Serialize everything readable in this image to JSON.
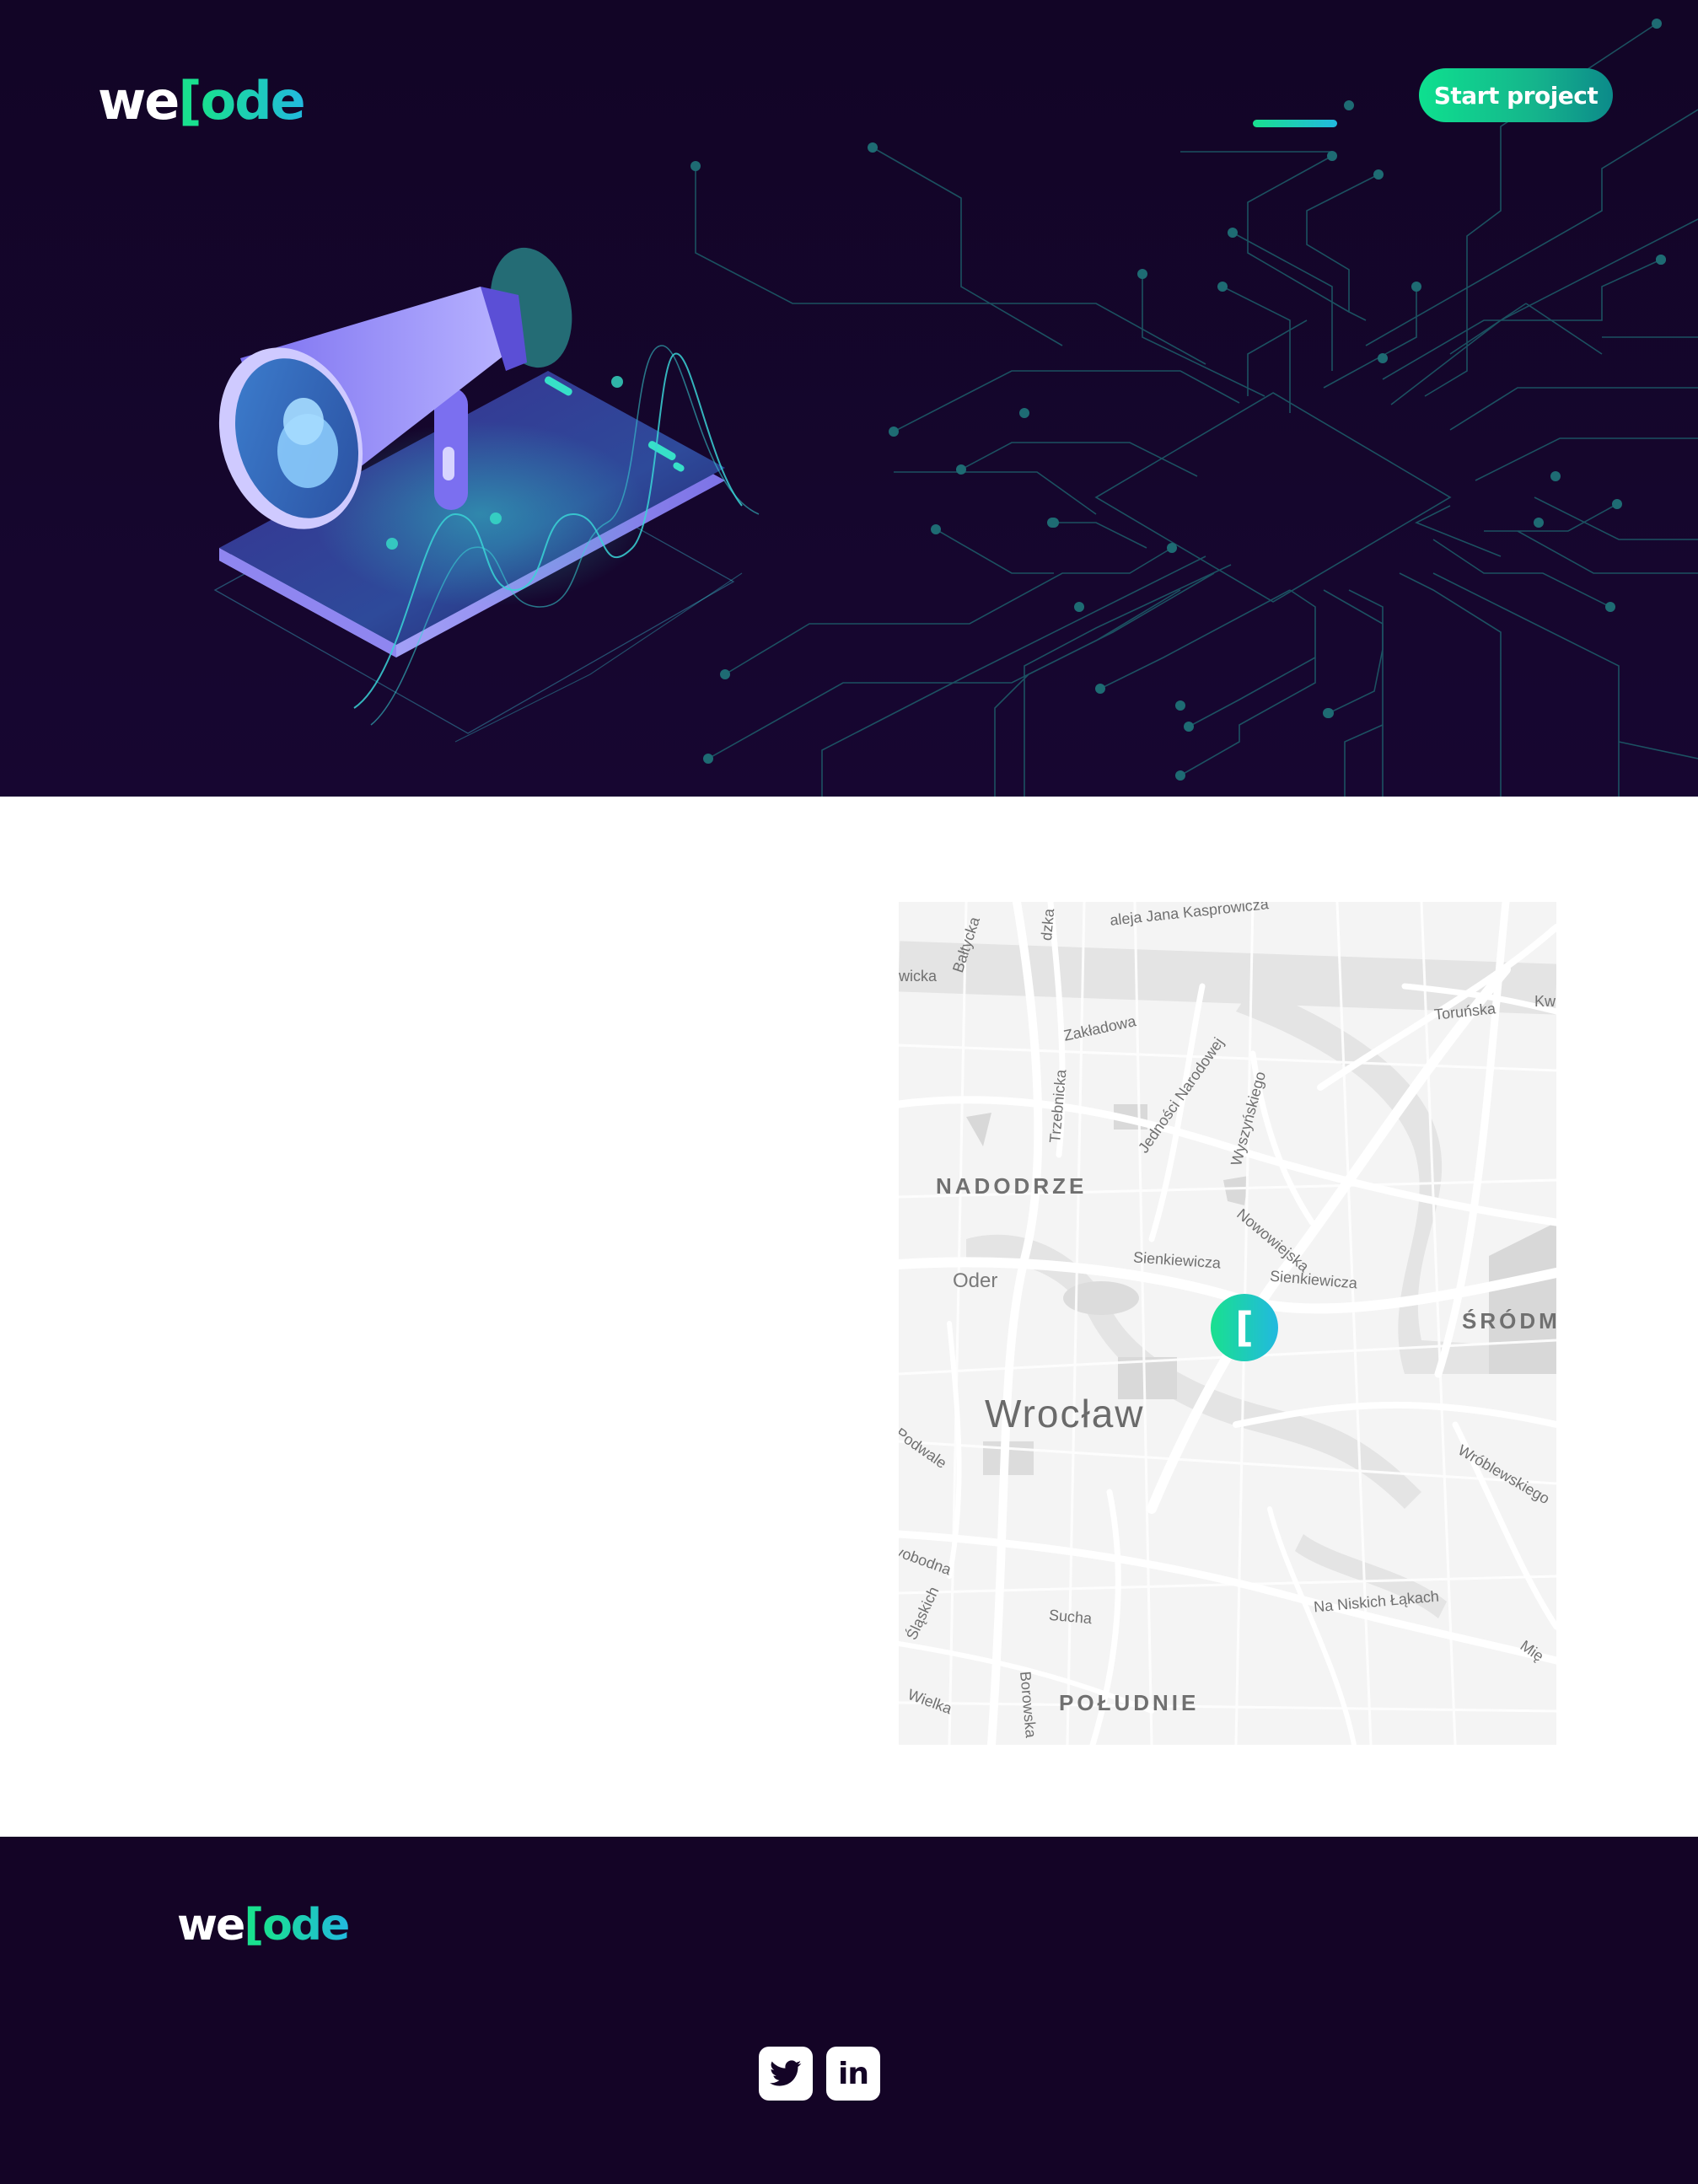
{
  "brand": {
    "we": "we",
    "bracket": "[",
    "ode": "ode"
  },
  "header": {
    "cta_label": "Start project",
    "menu_icon": "menu-bar-icon"
  },
  "hero": {
    "illustration": "megaphone-on-smartphone-illustration",
    "background": "circuit-board-pattern"
  },
  "map": {
    "city": "Wrocław",
    "districts": [
      "NADODRZE",
      "ŚRÓDMIE",
      "POŁUDNIE"
    ],
    "river": "Oder",
    "streets": [
      "aleja Jana Kasprowicza",
      "Bałtycka",
      "wicka",
      "Zakładowa",
      "Toruńska",
      "Trzebnicka",
      "Jedności Narodowej",
      "Wyszyńskiego",
      "Nowowiejska",
      "Sienkiewicza",
      "Sienkiewicza",
      "Podwale",
      "Wróblewskiego",
      "vobodna",
      "Śląskich",
      "Sucha",
      "Na Niskich Łąkach",
      "Wielka",
      "Borowska",
      "Kw",
      "Mię",
      "dzka"
    ],
    "pin_glyph": "["
  },
  "footer": {
    "social": [
      "twitter",
      "linkedin"
    ],
    "twitter_glyph": "twitter-icon",
    "linkedin_glyph": "in"
  },
  "colors": {
    "accent_green": "#19e08f",
    "accent_cyan": "#22b9df",
    "hero_bg": "#120526",
    "footer_bg": "#140426",
    "map_bg": "#f4f4f4"
  }
}
